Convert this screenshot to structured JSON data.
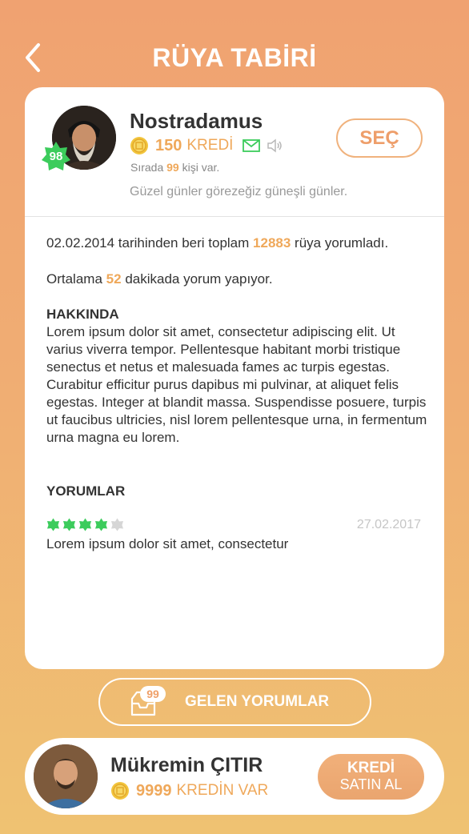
{
  "header": {
    "title": "RÜYA TABİRİ",
    "back_icon": "chevron-left-icon"
  },
  "interpreter": {
    "name": "Nostradamus",
    "level": "98",
    "credit_value": "150",
    "credit_label": "KREDİ",
    "rank_prefix": "Sırada",
    "rank_value": "99",
    "rank_suffix": "kişi var.",
    "motto": "Güzel günler görezeğiz güneşli günler.",
    "select_label": "SEÇ",
    "icons": [
      "coin-icon",
      "mail-icon",
      "speaker-icon"
    ]
  },
  "stats": {
    "since_prefix": "02.02.2014 tarihinden beri toplam",
    "since_count": "12883",
    "since_suffix": "rüya yorumladı.",
    "avg_prefix": "Ortalama",
    "avg_value": "52",
    "avg_suffix": "dakikada yorum yapıyor."
  },
  "about": {
    "title": "HAKKINDA",
    "text": "Lorem ipsum dolor sit amet, consectetur adipiscing elit. Ut varius viverra tempor. Pellentesque habitant morbi tristique senectus et netus et malesuada fames ac turpis egestas. Curabitur efficitur purus dapibus mi pulvinar, at aliquet felis egestas. Integer at blandit massa. Suspendisse posuere, turpis ut faucibus ultricies, nisl lorem pellentesque urna, in fermentum urna magna eu lorem."
  },
  "reviews": {
    "title": "YORUMLAR",
    "items": [
      {
        "rating": 4,
        "max": 5,
        "date": "27.02.2017",
        "text": "Lorem ipsum dolor sit amet, consectetur"
      }
    ]
  },
  "received": {
    "count": "99",
    "label": "GELEN YORUMLAR"
  },
  "user": {
    "name": "Mükremin ÇITIR",
    "credit_value": "9999",
    "credit_label": "KREDİN VAR",
    "buy_line1": "KREDİ",
    "buy_line2": "SATIN AL"
  },
  "colors": {
    "accent": "#efa85a",
    "green": "#3ccc5c",
    "bg_top": "#f0a271",
    "bg_bottom": "#efc272"
  }
}
